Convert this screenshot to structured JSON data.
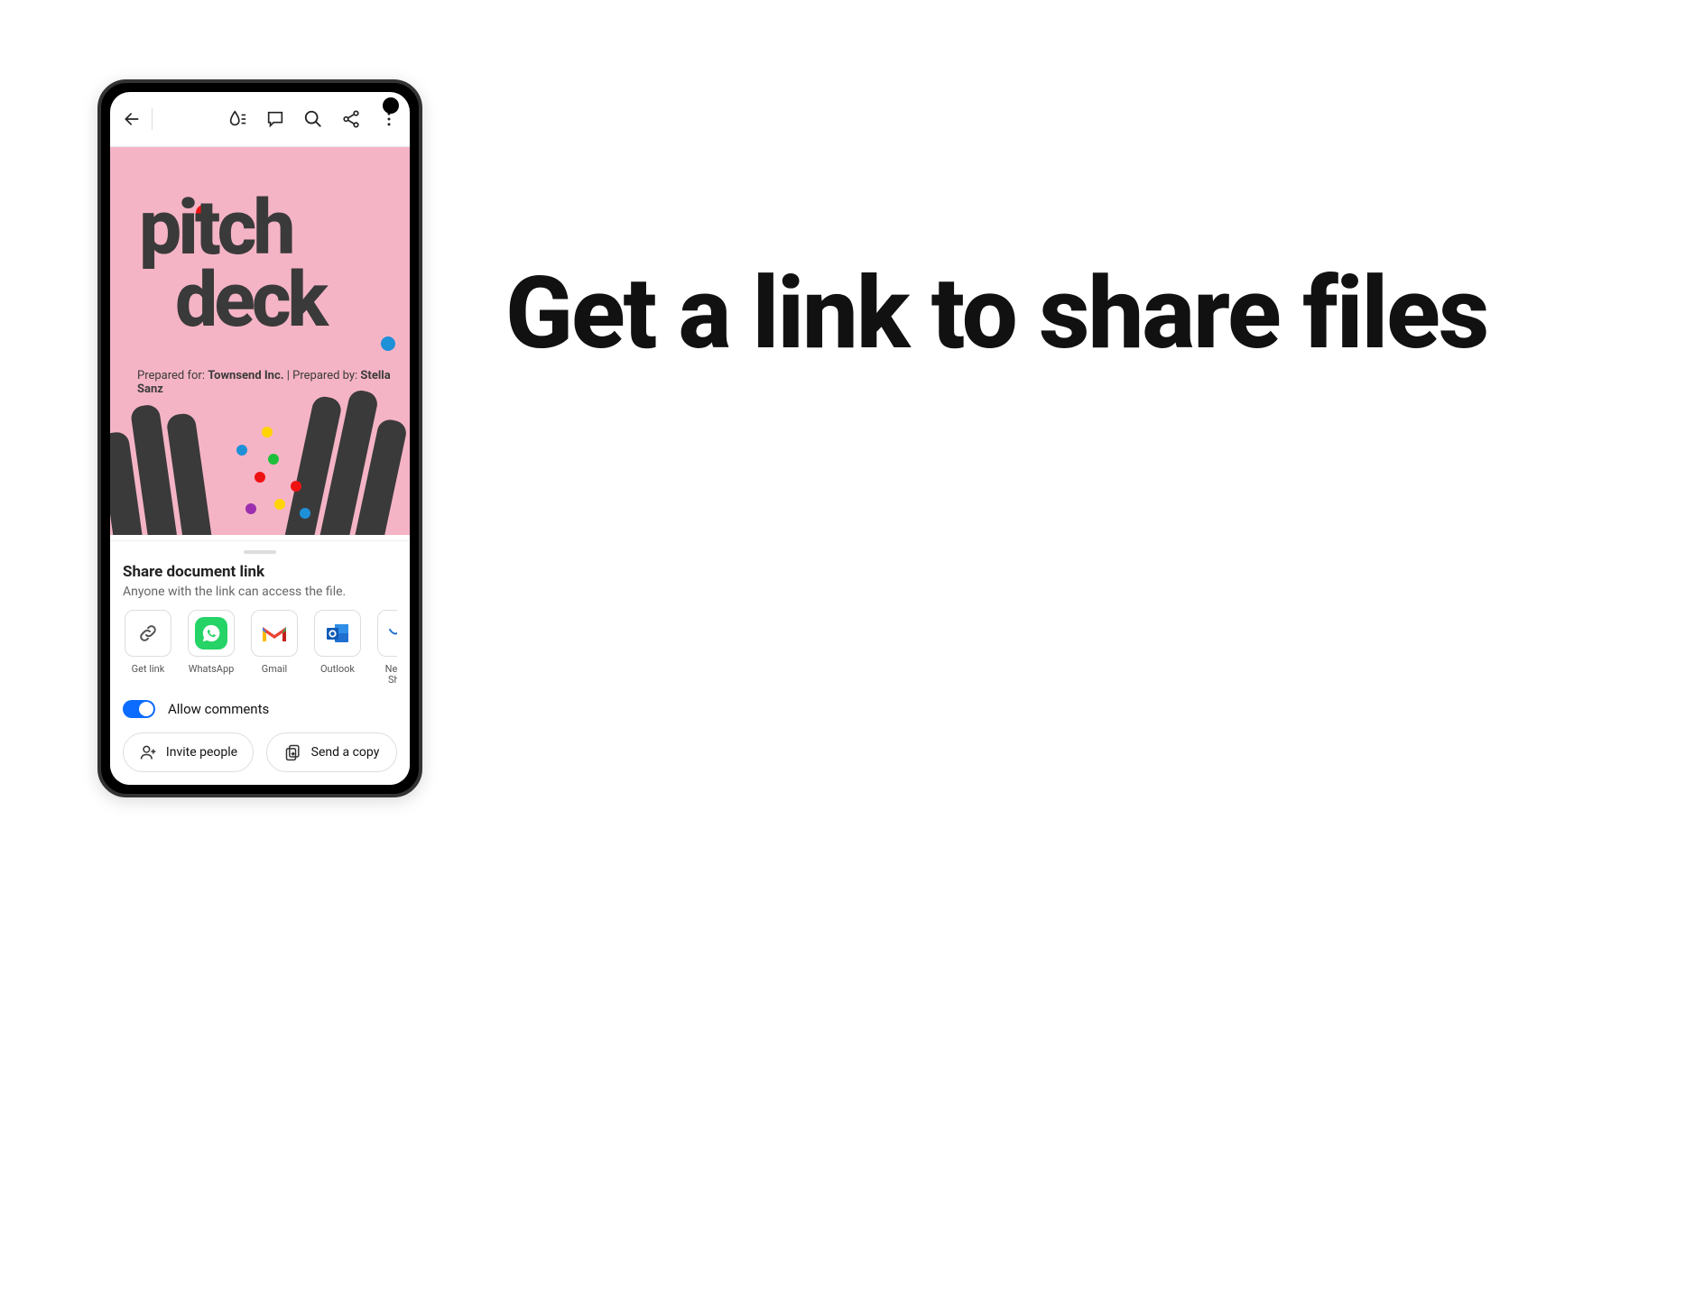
{
  "headline": "Get a link to share files",
  "document": {
    "title_line1": "pitch",
    "title_line2": "deck",
    "prepared_for_label": "Prepared for:",
    "prepared_for_value": "Townsend Inc.",
    "prepared_by_label": "Prepared by:",
    "prepared_by_value": "Stella Sanz"
  },
  "toolbar": {
    "back_icon": "back-icon",
    "liquid_icon": "liquid-mode-icon",
    "comment_icon": "comment-icon",
    "search_icon": "search-icon",
    "share_icon": "share-icon",
    "more_icon": "more-icon"
  },
  "share_sheet": {
    "title": "Share document link",
    "subtitle": "Anyone with the link can access the file.",
    "apps": [
      {
        "id": "get-link",
        "label": "Get link"
      },
      {
        "id": "whatsapp",
        "label": "WhatsApp"
      },
      {
        "id": "gmail",
        "label": "Gmail"
      },
      {
        "id": "outlook",
        "label": "Outlook"
      },
      {
        "id": "nearby",
        "label": "Nearby Share"
      }
    ],
    "allow_comments_label": "Allow comments",
    "allow_comments_on": true,
    "invite_label": "Invite people",
    "send_copy_label": "Send a copy"
  }
}
